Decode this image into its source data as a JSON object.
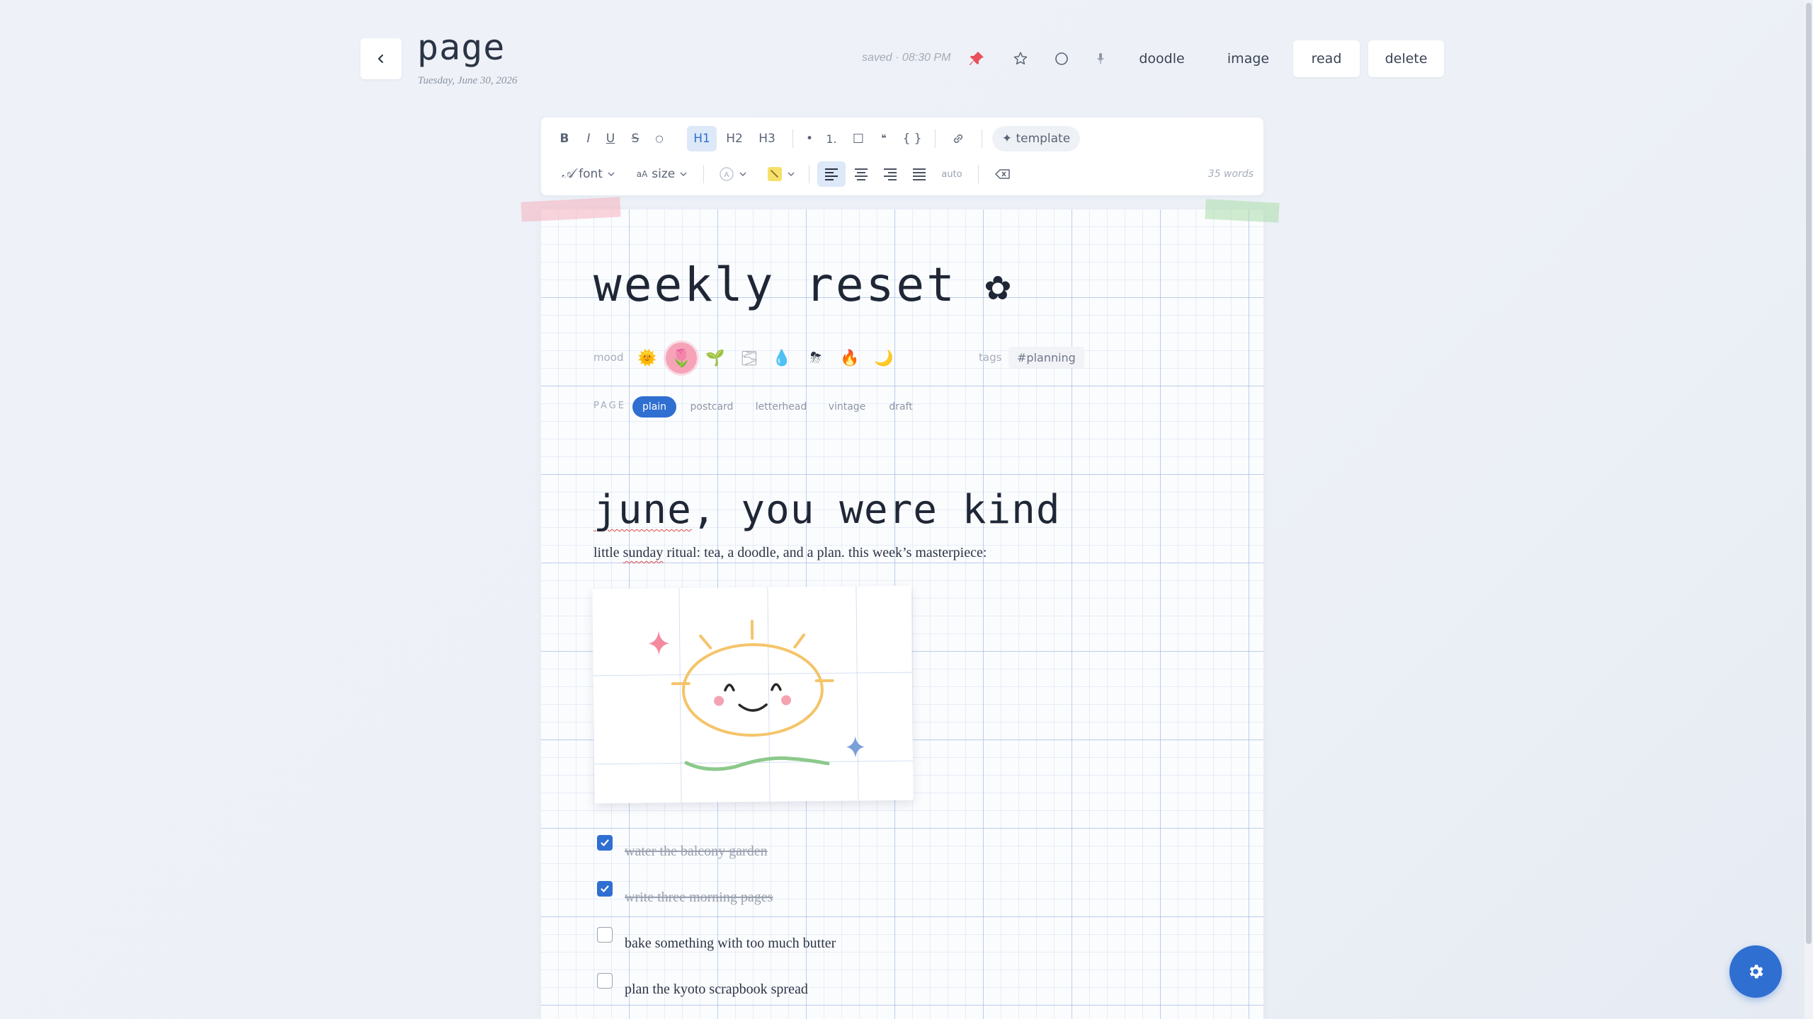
{
  "header": {
    "title": "page",
    "date": "Tuesday, June 30, 2026",
    "saved_status": "saved · 08:30 PM",
    "icons": [
      "back-icon",
      "pin-icon",
      "star-icon",
      "circle-icon",
      "mic-icon"
    ],
    "buttons": {
      "doodle": "doodle",
      "image": "image",
      "read": "read",
      "delete": "delete"
    }
  },
  "toolbar": {
    "bold": "B",
    "italic": "I",
    "underline": "U",
    "strike": "S",
    "code_inline": "○",
    "h1": "H1",
    "h2": "H2",
    "h3": "H3",
    "bullet": "•",
    "numbered": "1.",
    "checkbox": "☐",
    "quote": "❝",
    "code_block": "{ }",
    "template": "✦ template",
    "font": "font",
    "size_prefix": "aA",
    "size": "size",
    "auto": "auto",
    "word_count": "35 words"
  },
  "editor": {
    "title": "weekly reset",
    "title_icon": "✿",
    "mood_label": "mood",
    "moods": [
      "🌞",
      "🌷",
      "🌱",
      "🌫",
      "💧",
      "⛈",
      "🔥",
      "🌙"
    ],
    "selected_mood_index": 1,
    "tags_label": "tags",
    "tags": [
      "#planning"
    ],
    "page_label": "PAGE",
    "page_styles": [
      "plain",
      "postcard",
      "letterhead",
      "vintage",
      "draft"
    ],
    "active_page_style": "plain",
    "heading_prefix": "june",
    "heading_rest": ", you were kind",
    "para_before": "little ",
    "para_squiggle": "sunday",
    "para_after": " ritual: tea, a doodle, and a plan. this week’s masterpiece:",
    "tasks": [
      {
        "text": "water the balcony garden",
        "done": true
      },
      {
        "text": "write three morning pages",
        "done": true
      },
      {
        "text": "bake something with too much butter",
        "done": false
      },
      {
        "text": "plan the kyoto scrapbook spread",
        "done": false
      }
    ]
  },
  "colors": {
    "accent": "#2f6fd1",
    "pin": "#e8505b",
    "sun": "#f5c46a",
    "star_pink": "#f48aa0",
    "star_blue": "#7b9fd8",
    "wave": "#8cc98c"
  }
}
